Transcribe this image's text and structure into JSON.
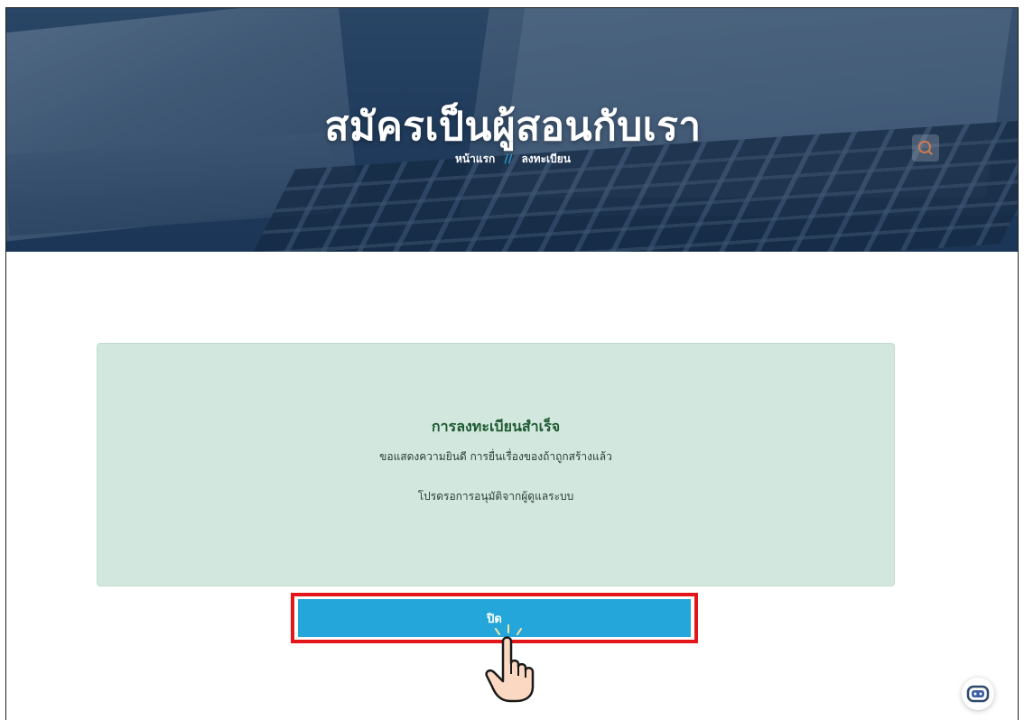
{
  "hero": {
    "title": "สมัครเป็นผู้สอนกับเรา",
    "breadcrumb": {
      "home": "หน้าแรก",
      "separator": "//",
      "current": "ลงทะเบียน"
    }
  },
  "alert": {
    "title": "การลงทะเบียนสำเร็จ",
    "message": "ขอแสดงความยินดี การยื่นเรื่องของถ้าถูกสร้างแล้ว",
    "note": "โปรดรอการอนุมัติจากผู้ดูแลระบบ"
  },
  "actions": {
    "close_label": "ปิด"
  },
  "colors": {
    "button": "#25a6da",
    "panel": "#d2e7dd",
    "panel_title": "#1e5a32",
    "highlight": "#e3161b",
    "breadcrumb_separator": "#29a3d6"
  },
  "icons": {
    "search": "search-icon",
    "pointer": "hand-pointer-icon",
    "chatbot": "chatbot-icon"
  }
}
